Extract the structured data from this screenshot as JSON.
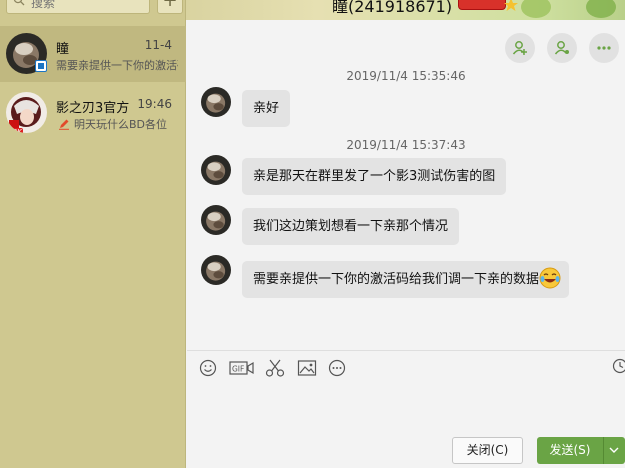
{
  "sidebar": {
    "search_placeholder": "搜索",
    "conversations": [
      {
        "name": "瞳",
        "time": "11-4",
        "preview": "需要亲提供一下你的激活码给我们调一下亲的数据"
      },
      {
        "name": "影之刃3官方",
        "time": "19:46",
        "preview": "明天玩什么BD各位"
      }
    ],
    "avatar_tag": "3K"
  },
  "header": {
    "title": "瞳(241918671)"
  },
  "chat": {
    "messages": [
      {
        "timestamp": "2019/11/4 15:35:46",
        "text": "亲好"
      },
      {
        "timestamp": "2019/11/4 15:37:43",
        "text": "亲是那天在群里发了一个影3测试伤害的图"
      },
      {
        "timestamp": "",
        "text": "我们这边策划想看一下亲那个情况"
      },
      {
        "timestamp": "",
        "text": "需要亲提供一下你的激活码给我们调一下亲的数据"
      }
    ]
  },
  "footer": {
    "close_label": "关闭(C)",
    "send_label": "发送(S)"
  },
  "icons": {
    "header_actions": [
      "add-friend-icon",
      "invite-icon",
      "more-icon"
    ],
    "toolbar": [
      "emoji-icon",
      "gif-icon",
      "scissors-icon",
      "image-icon",
      "chat-bubble-icon",
      "history-icon"
    ]
  },
  "colors": {
    "sidebar": "#cfc890",
    "send_button": "#6aa445",
    "bubble": "#e3e3e3"
  }
}
